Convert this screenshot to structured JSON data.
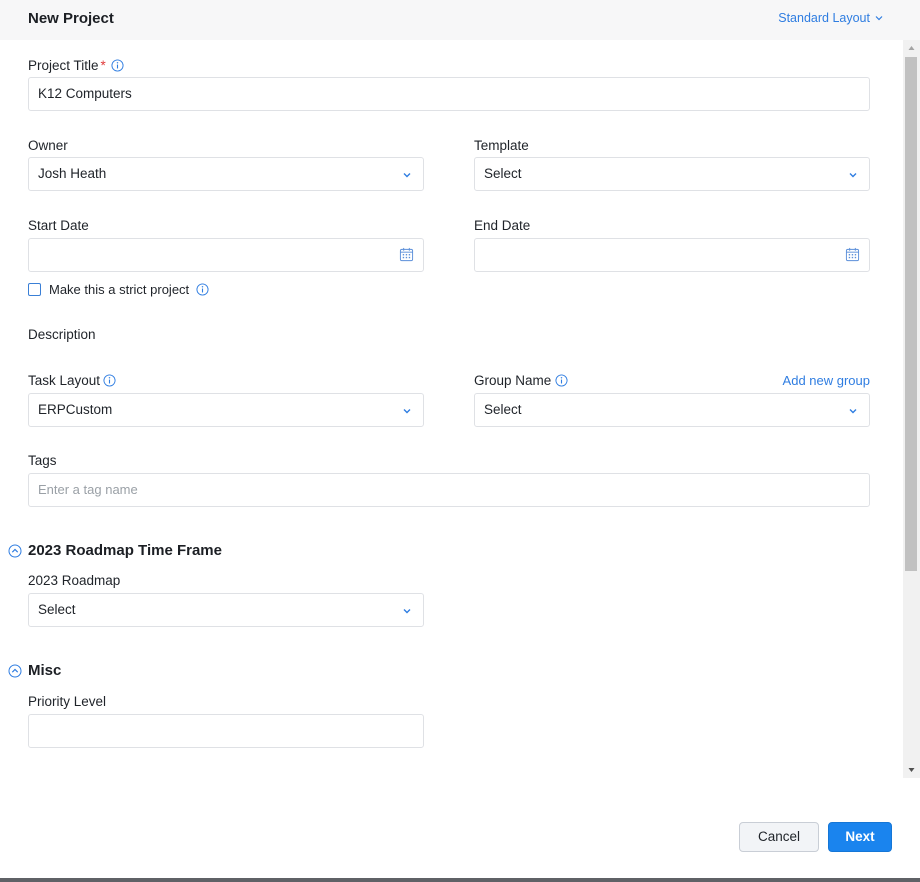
{
  "header": {
    "title": "New Project",
    "layout_label": "Standard Layout"
  },
  "form": {
    "project_title": {
      "label": "Project Title",
      "required_mark": "*",
      "value": "K12 Computers"
    },
    "owner": {
      "label": "Owner",
      "value": "Josh Heath"
    },
    "template": {
      "label": "Template",
      "value": "Select"
    },
    "start_date": {
      "label": "Start Date",
      "value": ""
    },
    "end_date": {
      "label": "End Date",
      "value": ""
    },
    "strict": {
      "label": "Make this a strict project",
      "checked": false
    },
    "description": {
      "label": "Description"
    },
    "task_layout": {
      "label": "Task Layout",
      "value": "ERPCustom"
    },
    "group_name": {
      "label": "Group Name",
      "value": "Select",
      "add_link": "Add new group"
    },
    "tags": {
      "label": "Tags",
      "placeholder": "Enter a tag name"
    }
  },
  "sections": {
    "roadmap": {
      "title": "2023 Roadmap Time Frame",
      "field_label": "2023 Roadmap",
      "field_value": "Select"
    },
    "misc": {
      "title": "Misc",
      "field_label": "Priority Level",
      "field_value": ""
    }
  },
  "footer": {
    "cancel_label": "Cancel",
    "next_label": "Next"
  },
  "colors": {
    "accent": "#1a84ee",
    "link": "#2f7de1",
    "required": "#e03a3a",
    "border": "#dfe1e5"
  },
  "icons": {
    "info": "info-icon",
    "chevron": "chevron-down-icon",
    "calendar": "calendar-icon",
    "collapse": "collapse-up-icon"
  }
}
